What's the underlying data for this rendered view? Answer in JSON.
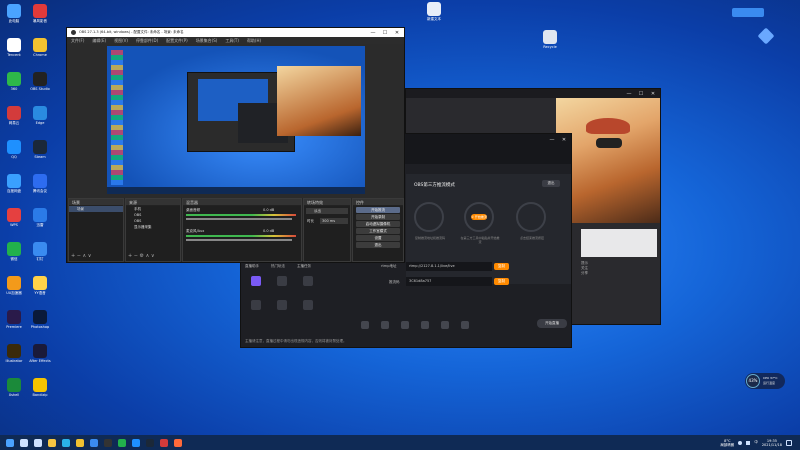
{
  "desktop_icons": [
    {
      "label": "此电脑",
      "color": "#4aa3ff"
    },
    {
      "label": "暴风影音",
      "color": "#e03a3a"
    },
    {
      "label": "Tencent",
      "color": "#ffffff"
    },
    {
      "label": "Chrome",
      "color": "#f2c230"
    },
    {
      "label": "360",
      "color": "#2eb84a"
    },
    {
      "label": "OBS Studio",
      "color": "#222222"
    },
    {
      "label": "网易云",
      "color": "#d33b3b"
    },
    {
      "label": "Edge",
      "color": "#2a8be0"
    },
    {
      "label": "QQ",
      "color": "#1e90ff"
    },
    {
      "label": "Steam",
      "color": "#1b2838"
    },
    {
      "label": "百度网盘",
      "color": "#3aa0ff"
    },
    {
      "label": "腾讯会议",
      "color": "#2d6cf0"
    },
    {
      "label": "WPS",
      "color": "#e54040"
    },
    {
      "label": "迅雷",
      "color": "#2b7be8"
    },
    {
      "label": "微信",
      "color": "#22b14c"
    },
    {
      "label": "钉钉",
      "color": "#3a8bf0"
    },
    {
      "label": "UU加速器",
      "color": "#f39a1a"
    },
    {
      "label": "YY语音",
      "color": "#ffd24a"
    },
    {
      "label": "Premiere",
      "color": "#2a1a4a"
    },
    {
      "label": "Photoshop",
      "color": "#0a1a3a"
    },
    {
      "label": "Illustrator",
      "color": "#3a2a0a"
    },
    {
      "label": "After Effects",
      "color": "#1a1a3a"
    },
    {
      "label": "Xshell",
      "color": "#1b8a3a"
    },
    {
      "label": "Bandizip",
      "color": "#f5c400"
    }
  ],
  "right_desktop_icons": [
    {
      "label": "新建文本",
      "color": "#e8eef8"
    },
    {
      "label": "Recycle",
      "color": "#dfe6f0"
    }
  ],
  "obs": {
    "title": "OBS 27.1.3 (64-bit, windows) - 配置文件: 未命名 - 场景: 未命名",
    "menus": [
      "文件(F)",
      "编辑(E)",
      "视图(V)",
      "停靠部件(D)",
      "配置文件(P)",
      "场景集合(S)",
      "工具(T)",
      "帮助(H)"
    ],
    "dock_scenes": "场景",
    "dock_sources": "来源",
    "dock_mixer": "混音器",
    "dock_transitions": "转场特效",
    "dock_controls": "控件",
    "scenes": [
      "场景"
    ],
    "sources": [
      "手机",
      "OBS",
      "OBS",
      "显示器采集"
    ],
    "mixer": [
      {
        "name": "桌面音频",
        "db": "0.0 dB"
      },
      {
        "name": "麦克风/Aux",
        "db": "0.0 dB"
      }
    ],
    "transition": {
      "label": "淡出",
      "duration_label": "时长",
      "duration": "300 ms"
    },
    "controls": [
      "开始推流",
      "开始录制",
      "启动虚拟摄像机",
      "工作室模式",
      "设置",
      "退出"
    ],
    "status": "LIVE: 00:00:00  REC: 00:00:00  CPU: 2.3%, 60.00 fps"
  },
  "live_app": {
    "title": "OBS第三方推流模式",
    "close_btn": "退出",
    "steps": [
      "① 推流码",
      "② 开始推流",
      "③ 结束推流"
    ],
    "step_desc": [
      "复制推流地址和推流码",
      "在第三方工具中粘贴并开始推流",
      "点击结束推流按钮"
    ],
    "rtmp_label": "rtmp地址",
    "rtmp_value": "rtmp://2127.8.1.1/live/live",
    "key_label": "推流码",
    "key_value": "3C61d8a757",
    "copy": "复制",
    "left_tabs": [
      "直播助手",
      "热门玩法",
      "主播任务"
    ],
    "left_items": [
      "弹幕",
      "礼物",
      "推流",
      "直播间",
      "连麦PK",
      "上一场"
    ],
    "toolbar": [
      "美颜",
      "滤镜",
      "贴纸",
      "画质",
      "音效",
      "更多"
    ],
    "start_btn": "开始直播",
    "notice": "主播请注意，直播过程中请勿出现违规内容，否则将被封禁处理。"
  },
  "bg_window": {
    "title": "",
    "side_text": [
      "提示",
      "关注",
      "分享"
    ]
  },
  "floater": {
    "badge": "43%",
    "line1": "CPU 37°C",
    "line2": "运行温度"
  },
  "taskbar": {
    "icons": [
      {
        "name": "windows-start-icon",
        "color": "#4aa3ff"
      },
      {
        "name": "search-icon",
        "color": "#cfe2ff"
      },
      {
        "name": "task-view-icon",
        "color": "#cfe2ff"
      },
      {
        "name": "explorer-icon",
        "color": "#f5c542"
      },
      {
        "name": "edge-icon",
        "color": "#2ab2e8"
      },
      {
        "name": "chrome-icon",
        "color": "#f2c230"
      },
      {
        "name": "store-icon",
        "color": "#3a8bf0"
      },
      {
        "name": "obs-icon",
        "color": "#333333"
      },
      {
        "name": "wechat-icon",
        "color": "#22b14c"
      },
      {
        "name": "qq-icon",
        "color": "#1e90ff"
      },
      {
        "name": "steam-icon",
        "color": "#1b2838"
      },
      {
        "name": "music-icon",
        "color": "#d33b3b"
      },
      {
        "name": "live-icon",
        "color": "#ff6a3a"
      }
    ],
    "weather": "8°C",
    "weather_desc": "局部晴朗",
    "lang": "中",
    "time": "19:35",
    "date": "2021/11/18"
  }
}
